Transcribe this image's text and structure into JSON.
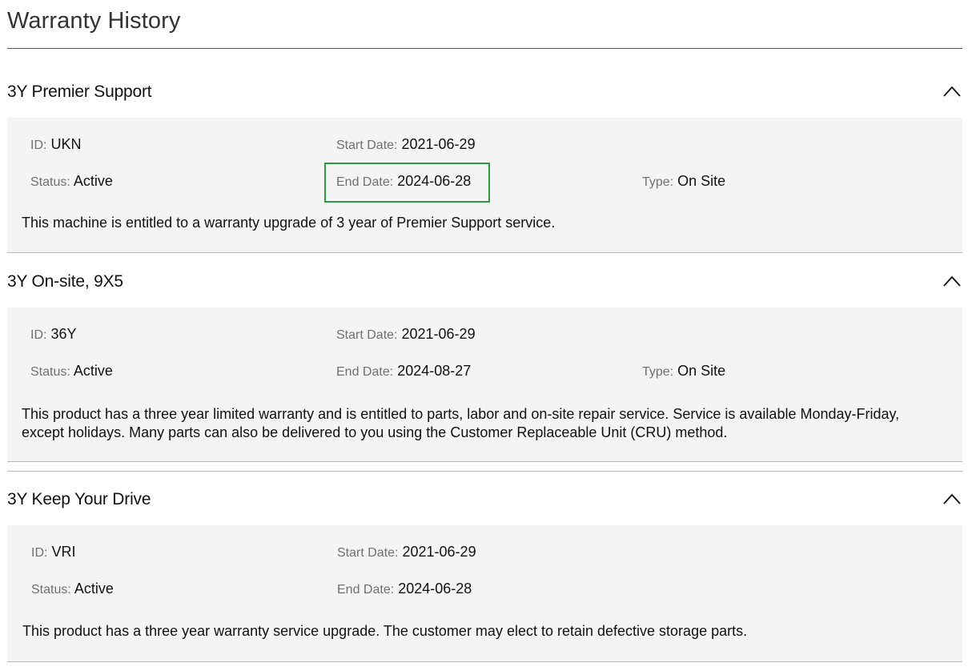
{
  "page": {
    "title": "Warranty History"
  },
  "labels": {
    "id": "ID",
    "status": "Status",
    "start_date": "Start Date",
    "end_date": "End Date",
    "type": "Type",
    "colon": ":"
  },
  "warranties": [
    {
      "title": "3Y Premier Support",
      "id": "UKN",
      "status": "Active",
      "start_date": "2021-06-29",
      "end_date": "2024-06-28",
      "type": "On Site",
      "description": "This machine is entitled to a warranty upgrade of 3 year of Premier Support service.",
      "expanded": true,
      "end_date_highlighted": true
    },
    {
      "title": "3Y On-site, 9X5",
      "id": "36Y",
      "status": "Active",
      "start_date": "2021-06-29",
      "end_date": "2024-08-27",
      "type": "On Site",
      "description": "This product has a three year limited warranty and is entitled to parts, labor and on-site repair service. Service is available Monday-Friday, except holidays. Many parts can also be delivered to you using the Customer Replaceable Unit (CRU) method.",
      "expanded": true
    },
    {
      "title": "3Y Keep Your Drive",
      "id": "VRI",
      "status": "Active",
      "start_date": "2021-06-29",
      "end_date": "2024-06-28",
      "description": "This product has a three year warranty service upgrade. The customer may elect to retain defective storage parts.",
      "expanded": true
    }
  ],
  "colors": {
    "panel_background": "#f4f4f4",
    "highlight_border": "#2e9a48",
    "label_gray": "#707070"
  },
  "icons": {
    "collapse": "chevron-up-icon"
  }
}
